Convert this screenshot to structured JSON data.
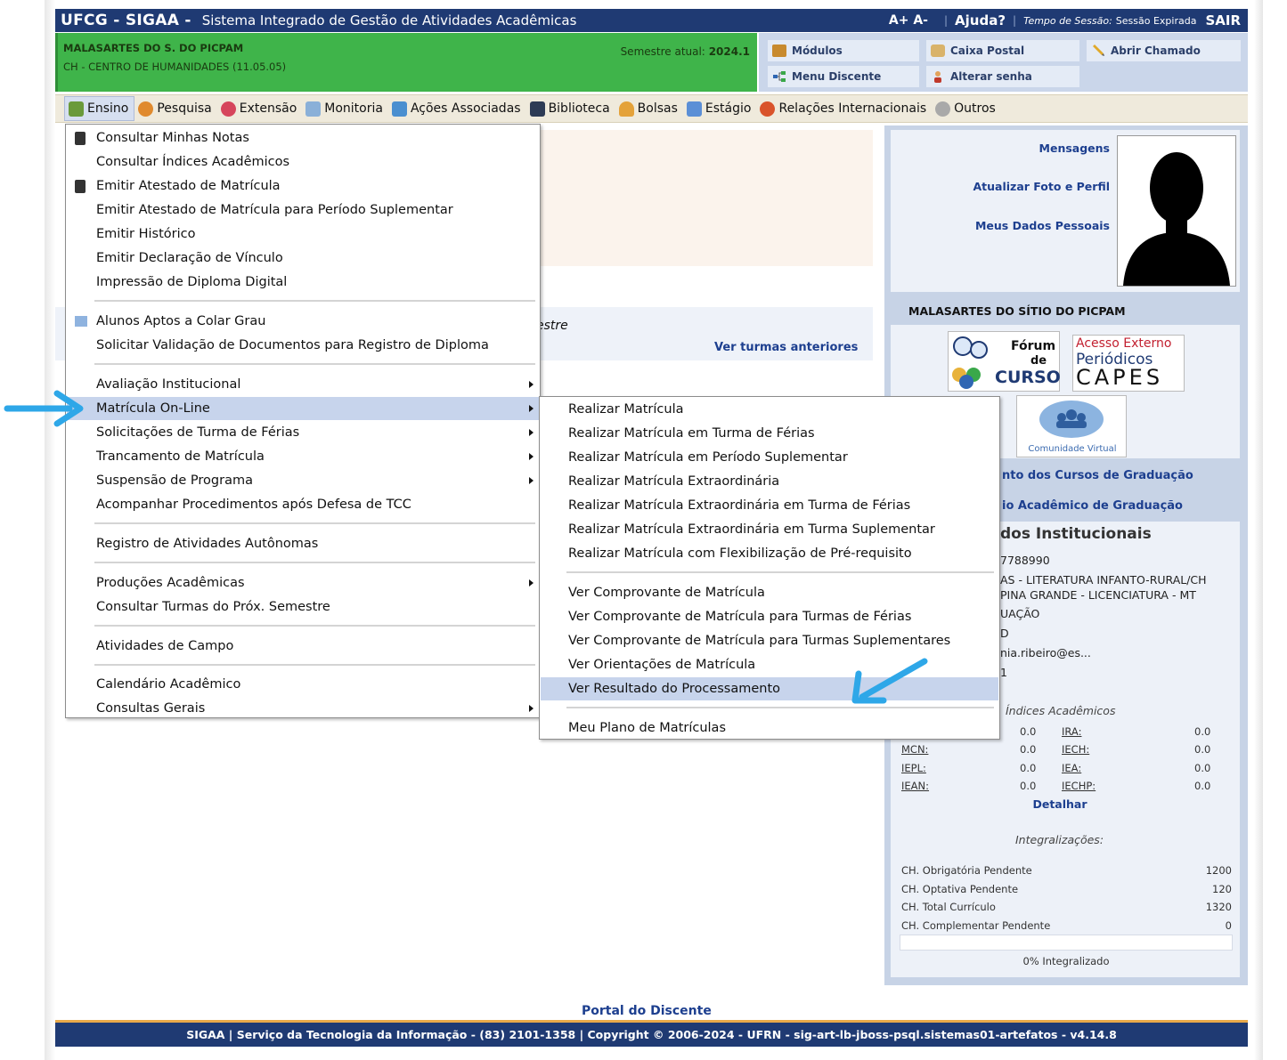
{
  "header": {
    "brand": "UFCG - SIGAA -",
    "system_name": "Sistema Integrado de Gestão de Atividades Acadêmicas",
    "font_controls": "A+ A-",
    "help": "Ajuda?",
    "session_label": "Tempo de Sessão:",
    "session_value": "Sessão Expirada",
    "exit": "SAIR"
  },
  "user": {
    "name": "MALASARTES DO S. DO PICPAM",
    "center": "CH - CENTRO DE HUMANIDADES (11.05.05)",
    "semester_label": "Semestre atual:",
    "semester_value": "2024.1"
  },
  "quick_links": {
    "modulos": "Módulos",
    "caixa_postal": "Caixa Postal",
    "abrir_chamado": "Abrir Chamado",
    "menu_discente": "Menu Discente",
    "alterar_senha": "Alterar senha"
  },
  "menubar": {
    "ensino": "Ensino",
    "pesquisa": "Pesquisa",
    "extensao": "Extensão",
    "monitoria": "Monitoria",
    "acoes": "Ações Associadas",
    "biblioteca": "Biblioteca",
    "bolsas": "Bolsas",
    "estagio": "Estágio",
    "relacoes": "Relações Internacionais",
    "outros": "Outros"
  },
  "ensino_menu": {
    "items": [
      "Consultar Minhas Notas",
      "Consultar Índices Acadêmicos",
      "Emitir Atestado de Matrícula",
      "Emitir Atestado de Matrícula para Período Suplementar",
      "Emitir Histórico",
      "Emitir Declaração de Vínculo",
      "Impressão de Diploma Digital",
      "Alunos Aptos a Colar Grau",
      "Solicitar Validação de Documentos para Registro de Diploma",
      "Avaliação Institucional",
      "Matrícula On-Line",
      "Solicitações de Turma de Férias",
      "Trancamento de Matrícula",
      "Suspensão de Programa",
      "Acompanhar Procedimentos após Defesa de TCC",
      "Registro de Atividades Autônomas",
      "Produções Acadêmicas",
      "Consultar Turmas do Próx. Semestre",
      "Atividades de Campo",
      "Calendário Acadêmico",
      "Consultas Gerais"
    ]
  },
  "matricula_menu": {
    "items": [
      "Realizar Matrícula",
      "Realizar Matrícula em Turma de Férias",
      "Realizar Matrícula em Período Suplementar",
      "Realizar Matrícula Extraordinária",
      "Realizar Matrícula Extraordinária em Turma de Férias",
      "Realizar Matrícula Extraordinária em Turma Suplementar",
      "Realizar Matrícula com Flexibilização de Pré-requisito",
      "Ver Comprovante de Matrícula",
      "Ver Comprovante de Matrícula para Turmas de Férias",
      "Ver Comprovante de Matrícula para Turmas Suplementares",
      "Ver Orientações de Matrícula",
      "Ver Resultado do Processamento",
      "Meu Plano de Matrículas"
    ]
  },
  "main": {
    "turmas_partial": "estre",
    "ver_turmas": "Ver turmas anteriores"
  },
  "profile": {
    "mensagens": "Mensagens",
    "atualizar": "Atualizar Foto e Perfil",
    "dados": "Meus Dados Pessoais",
    "owner": "MALASARTES DO SÍTIO DO PICPAM",
    "forum_line1": "Fórum",
    "forum_line2": "de",
    "forum_line3": "CURSO",
    "capes_line1": "Acesso Externo",
    "capes_line2": "Periódicos",
    "capes_line3": "CAPES",
    "comunidade": "Comunidade Virtual",
    "regulamento": "nto dos Cursos de Graduação",
    "calendario": "io Acadêmico de Graduação",
    "dados_title": "dos Institucionais",
    "dados_lines": [
      "7788990",
      "AS - LITERATURA INFANTO-RURAL/CH",
      "PINA GRANDE - LICENCIATURA - MT",
      "UAÇÃO",
      "D",
      "nia.ribeiro@es...",
      "1"
    ],
    "indices_title": "Índices Acadêmicos",
    "indices": [
      {
        "label": "",
        "value": "0.0"
      },
      {
        "label": "IRA:",
        "value": "0.0"
      },
      {
        "label": "MCN:",
        "value": "0.0"
      },
      {
        "label": "IECH:",
        "value": "0.0"
      },
      {
        "label": "IEPL:",
        "value": "0.0"
      },
      {
        "label": "IEA:",
        "value": "0.0"
      },
      {
        "label": "IEAN:",
        "value": "0.0"
      },
      {
        "label": "IECHP:",
        "value": "0.0"
      }
    ],
    "detalhar": "Detalhar",
    "integralizacoes_title": "Integralizações:",
    "integralizacoes": [
      {
        "label": "CH. Obrigatória Pendente",
        "value": "1200"
      },
      {
        "label": "CH. Optativa Pendente",
        "value": "120"
      },
      {
        "label": "CH. Total Currículo",
        "value": "1320"
      },
      {
        "label": "CH. Complementar Pendente",
        "value": "0"
      }
    ],
    "progress": "0% Integralizado"
  },
  "footer": {
    "portal": "Portal do Discente",
    "text": "SIGAA | Serviço da Tecnologia da Informação - (83) 2101-1358 | Copyright © 2006-2024 - UFRN - sig-art-lb-jboss-psql.sistemas01-artefatos - v4.14.8"
  },
  "colors": {
    "header_blue": "#1f3a73",
    "user_green": "#3fb44a",
    "annotation_arrow": "#2ea7e8",
    "highlight": "#c7d4ec"
  }
}
